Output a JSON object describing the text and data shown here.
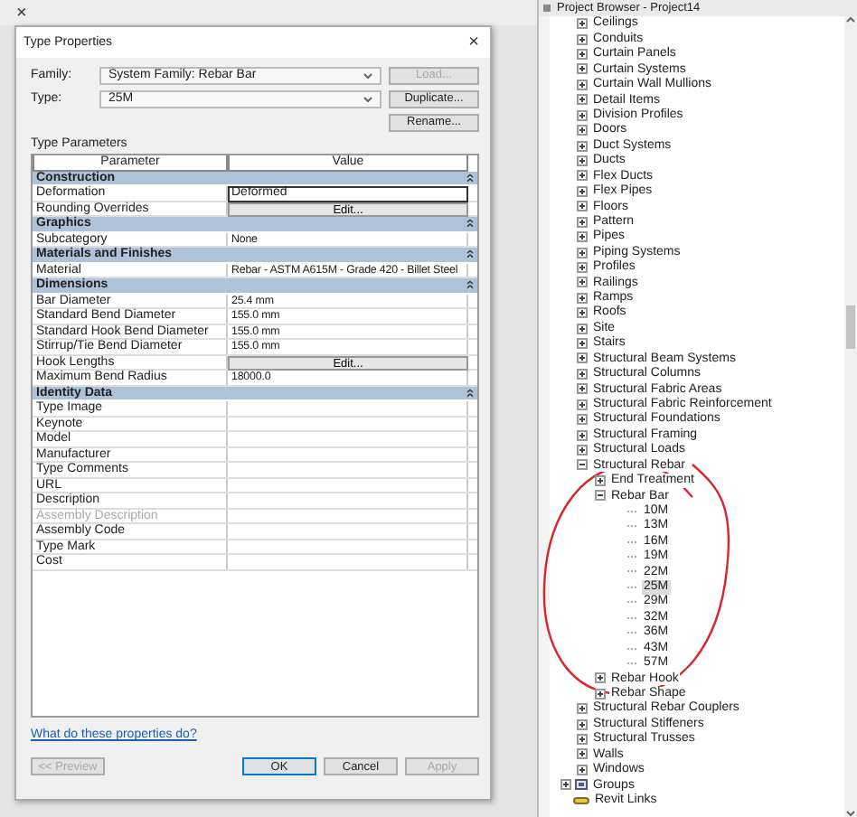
{
  "top_strip": {
    "close": "×"
  },
  "dialog": {
    "title": "Type Properties",
    "close": "×",
    "family": {
      "label": "Family:",
      "value": "System Family: Rebar Bar"
    },
    "type": {
      "label": "Type:",
      "value": "25M"
    },
    "side_buttons": [
      {
        "label": "Load...",
        "disabled": true
      },
      {
        "label": "Duplicate...",
        "disabled": false
      },
      {
        "label": "Rename...",
        "disabled": false
      }
    ],
    "section_label": "Type Parameters",
    "columns": [
      "Parameter",
      "Value"
    ],
    "groups": [
      {
        "title": "Construction",
        "rows": [
          {
            "name": "Deformation",
            "value": "Deformed",
            "kind": "field",
            "disabled": false
          },
          {
            "name": "Rounding Overrides",
            "value": "Edit...",
            "kind": "button",
            "disabled": false
          }
        ]
      },
      {
        "title": "Graphics",
        "rows": [
          {
            "name": "Subcategory",
            "value": "None",
            "kind": "text",
            "disabled": false
          }
        ]
      },
      {
        "title": "Materials and Finishes",
        "rows": [
          {
            "name": "Material",
            "value": "Rebar - ASTM A615M - Grade 420 - Billet Steel",
            "kind": "text",
            "disabled": false
          }
        ]
      },
      {
        "title": "Dimensions",
        "rows": [
          {
            "name": "Bar Diameter",
            "value": "25.4 mm",
            "kind": "text",
            "disabled": false
          },
          {
            "name": "Standard Bend Diameter",
            "value": "155.0 mm",
            "kind": "text",
            "disabled": false
          },
          {
            "name": "Standard Hook Bend Diameter",
            "value": "155.0 mm",
            "kind": "text",
            "disabled": false
          },
          {
            "name": "Stirrup/Tie Bend Diameter",
            "value": "155.0 mm",
            "kind": "text",
            "disabled": false
          },
          {
            "name": "Hook Lengths",
            "value": "Edit...",
            "kind": "button",
            "disabled": false
          },
          {
            "name": "Maximum Bend Radius",
            "value": "18000.0",
            "kind": "text",
            "disabled": false
          }
        ]
      },
      {
        "title": "Identity Data",
        "rows": [
          {
            "name": "Type Image",
            "kind": "empty",
            "disabled": false
          },
          {
            "name": "Keynote",
            "kind": "empty",
            "disabled": false
          },
          {
            "name": "Model",
            "kind": "empty",
            "disabled": false
          },
          {
            "name": "Manufacturer",
            "kind": "empty",
            "disabled": false
          },
          {
            "name": "Type Comments",
            "kind": "empty",
            "disabled": false
          },
          {
            "name": "URL",
            "kind": "empty",
            "disabled": false
          },
          {
            "name": "Description",
            "kind": "empty",
            "disabled": false
          },
          {
            "name": "Assembly Description",
            "kind": "empty",
            "disabled": true
          },
          {
            "name": "Assembly Code",
            "kind": "empty",
            "disabled": false
          },
          {
            "name": "Type Mark",
            "kind": "empty",
            "disabled": false
          },
          {
            "name": "Cost",
            "kind": "empty",
            "disabled": false
          }
        ]
      }
    ],
    "help_link": "What do these properties do?",
    "buttons": [
      {
        "label": "<< Preview",
        "disabled": true,
        "default": false
      },
      {
        "label": "OK",
        "disabled": false,
        "default": true
      },
      {
        "label": "Cancel",
        "disabled": false,
        "default": false
      },
      {
        "label": "Apply",
        "disabled": true,
        "default": false
      }
    ]
  },
  "project_browser": {
    "title": "Project Browser - Project14",
    "family_items": [
      {
        "label": "Ceilings",
        "expanded": false
      },
      {
        "label": "Conduits",
        "expanded": false
      },
      {
        "label": "Curtain Panels",
        "expanded": false
      },
      {
        "label": "Curtain Systems",
        "expanded": false
      },
      {
        "label": "Curtain Wall Mullions",
        "expanded": false
      },
      {
        "label": "Detail Items",
        "expanded": false
      },
      {
        "label": "Division Profiles",
        "expanded": false
      },
      {
        "label": "Doors",
        "expanded": false
      },
      {
        "label": "Duct Systems",
        "expanded": false
      },
      {
        "label": "Ducts",
        "expanded": false
      },
      {
        "label": "Flex Ducts",
        "expanded": false
      },
      {
        "label": "Flex Pipes",
        "expanded": false
      },
      {
        "label": "Floors",
        "expanded": false
      },
      {
        "label": "Pattern",
        "expanded": false
      },
      {
        "label": "Pipes",
        "expanded": false
      },
      {
        "label": "Piping Systems",
        "expanded": false
      },
      {
        "label": "Profiles",
        "expanded": false
      },
      {
        "label": "Railings",
        "expanded": false
      },
      {
        "label": "Ramps",
        "expanded": false
      },
      {
        "label": "Roofs",
        "expanded": false
      },
      {
        "label": "Site",
        "expanded": false
      },
      {
        "label": "Stairs",
        "expanded": false
      },
      {
        "label": "Structural Beam Systems",
        "expanded": false
      },
      {
        "label": "Structural Columns",
        "expanded": false
      },
      {
        "label": "Structural Fabric Areas",
        "expanded": false
      },
      {
        "label": "Structural Fabric Reinforcement",
        "expanded": false
      },
      {
        "label": "Structural Foundations",
        "expanded": false
      },
      {
        "label": "Structural Framing",
        "expanded": false
      },
      {
        "label": "Structural Loads",
        "expanded": false
      },
      {
        "label": "Structural Rebar",
        "expanded": true,
        "children": [
          {
            "label": "End Treatment",
            "expanded": false
          },
          {
            "label": "Rebar Bar",
            "expanded": true,
            "children": [
              {
                "label": "10M",
                "selected": false
              },
              {
                "label": "13M",
                "selected": false
              },
              {
                "label": "16M",
                "selected": false
              },
              {
                "label": "19M",
                "selected": false
              },
              {
                "label": "22M",
                "selected": false
              },
              {
                "label": "25M",
                "selected": true
              },
              {
                "label": "29M",
                "selected": false
              },
              {
                "label": "32M",
                "selected": false
              },
              {
                "label": "36M",
                "selected": false
              },
              {
                "label": "43M",
                "selected": false
              },
              {
                "label": "57M",
                "selected": false
              }
            ]
          },
          {
            "label": "Rebar Hook",
            "expanded": false
          },
          {
            "label": "Rebar Shape",
            "expanded": false
          }
        ]
      },
      {
        "label": "Structural Rebar Couplers",
        "expanded": false
      },
      {
        "label": "Structural Stiffeners",
        "expanded": false
      },
      {
        "label": "Structural Trusses",
        "expanded": false
      },
      {
        "label": "Walls",
        "expanded": false
      },
      {
        "label": "Windows",
        "expanded": false
      }
    ],
    "root_items": [
      {
        "label": "Groups",
        "kind": "groups",
        "expanded": false
      },
      {
        "label": "Revit Links",
        "kind": "links"
      }
    ]
  }
}
